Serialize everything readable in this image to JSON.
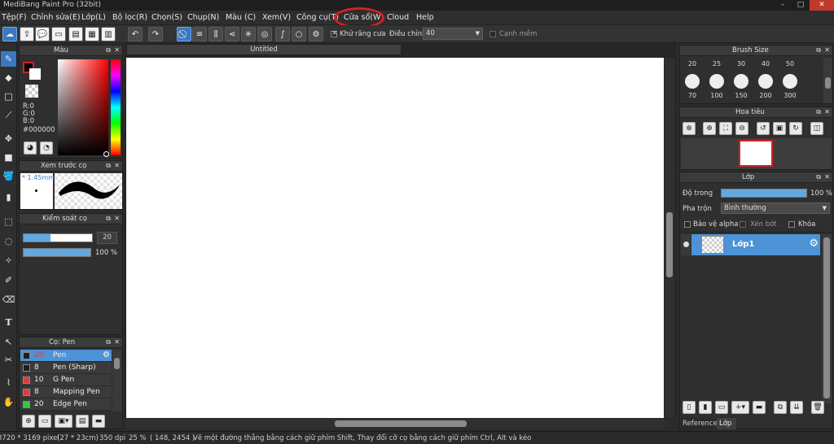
{
  "window": {
    "title": "MediBang Paint Pro (32bit)"
  },
  "menu": [
    "Tệp(F)",
    "Chỉnh sửa(E)",
    "Lớp(L)",
    "Bộ lọc(R)",
    "Chọn(S)",
    "Chụp(N)",
    "Màu (C)",
    "Xem(V)",
    "Công cụ(T)",
    "Cửa sổ(W)",
    "Cloud",
    "Help"
  ],
  "toolbar": {
    "antialias_label": "Khử răng cưa",
    "antialias_checked": true,
    "adjust_label": "Điều chỉnh",
    "adjust_value": "40",
    "sharp_edge_label": "Cạnh mềm",
    "sharp_edge_checked": false
  },
  "color_panel": {
    "title": "Màu",
    "r": "R:0",
    "g": "G:0",
    "b": "B:0",
    "hex": "#000000",
    "fg_color": "#000000"
  },
  "brush_preview": {
    "title": "Xem trước cọ",
    "size_label": "* 1.45mm"
  },
  "brush_control": {
    "title": "Kiểm soát cọ",
    "size_value": "20",
    "opacity_value": "100 %",
    "size_fraction": 0.39,
    "opacity_fraction": 1.0
  },
  "brush_list": {
    "title": "Cọ: Pen",
    "items": [
      {
        "size": "20",
        "name": "Pen",
        "color": "#1e1e1e",
        "selected": true
      },
      {
        "size": "8",
        "name": "Pen (Sharp)",
        "color": "#1e1e1e",
        "selected": false
      },
      {
        "size": "10",
        "name": "G Pen",
        "color": "#e23b3b",
        "selected": false
      },
      {
        "size": "8",
        "name": "Mapping Pen",
        "color": "#e23b3b",
        "selected": false
      },
      {
        "size": "20",
        "name": "Edge Pen",
        "color": "#2ecc40",
        "selected": false
      }
    ]
  },
  "canvas": {
    "tab_title": "Untitled"
  },
  "brush_size_panel": {
    "title": "Brush Size",
    "row1": [
      "20",
      "25",
      "30",
      "40",
      "50"
    ],
    "row2": [
      "70",
      "100",
      "150",
      "200",
      "300"
    ]
  },
  "navigator": {
    "title": "Hoa tiêu"
  },
  "layer_panel": {
    "title": "Lớp",
    "opacity_label": "Độ trong",
    "opacity_value": "100 %",
    "opacity_fraction": 1.0,
    "blend_label": "Pha trộn",
    "blend_value": "Bình thường",
    "protect_alpha": "Bảo vệ alpha",
    "clipping": "Xén bớt",
    "lock": "Khóa",
    "layers": [
      {
        "name": "Lớp1"
      }
    ],
    "bottom_tabs": [
      "Reference",
      "Lớp"
    ]
  },
  "status": {
    "size": "3720 * 3169 pixel",
    "cm": "(27 * 23cm)",
    "dpi": "350 dpi",
    "zoom": "25 %",
    "coords": "( 148, 2454 )",
    "hint": "Vẽ một đường thẳng bằng cách giữ phím Shift, Thay đổi cỡ cọ bằng cách giữ phím Ctrl, Alt và kéo"
  }
}
